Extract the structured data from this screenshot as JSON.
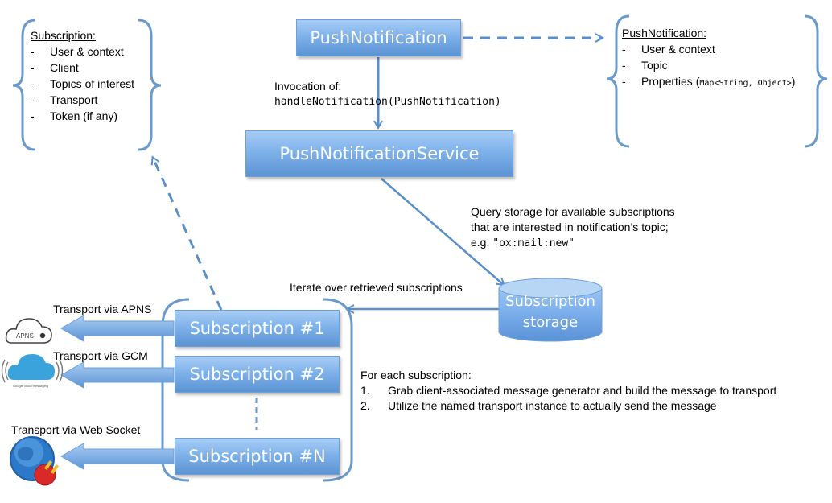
{
  "subscription_info": {
    "header": "Subscription:",
    "items": [
      "User & context",
      "Client",
      "Topics of interest",
      "Transport",
      "Token (if any)"
    ]
  },
  "push_notification_info": {
    "header": "PushNotification:",
    "items": [
      "User & context",
      "Topic"
    ],
    "properties_label": "Properties (",
    "properties_type": "Map<String, Object>",
    "properties_close": ")"
  },
  "boxes": {
    "push_notification": "PushNotification",
    "push_notification_service": "PushNotificationService",
    "subscription_1": "Subscription #1",
    "subscription_2": "Subscription #2",
    "subscription_n": "Subscription #N",
    "storage_line1": "Subscription",
    "storage_line2": "storage"
  },
  "invocation": {
    "label": "Invocation of:",
    "method": "handleNotification(PushNotification)"
  },
  "query": {
    "line1": "Query storage for available subscriptions",
    "line2": "that are interested in notification’s topic;",
    "line3_prefix": "e.g. ",
    "line3_code": "\"ox:mail:new\""
  },
  "iterate_label": "Iterate over retrieved subscriptions",
  "transports": {
    "apns": "Transport via APNS",
    "gcm": "Transport via GCM",
    "websocket": "Transport via Web Socket",
    "apns_icon_text": "APNS",
    "gcm_icon_text": "Google cloud messaging"
  },
  "for_each": {
    "title": "For each subscription:",
    "steps": [
      {
        "num": "1.",
        "text": "Grab client-associated message generator and build the message to transport"
      },
      {
        "num": "2.",
        "text": "Utilize the named transport instance to actually send the message"
      }
    ]
  },
  "colors": {
    "accent": "#5b93d4",
    "line": "#5a8fcc",
    "brace": "#6a9acb"
  }
}
